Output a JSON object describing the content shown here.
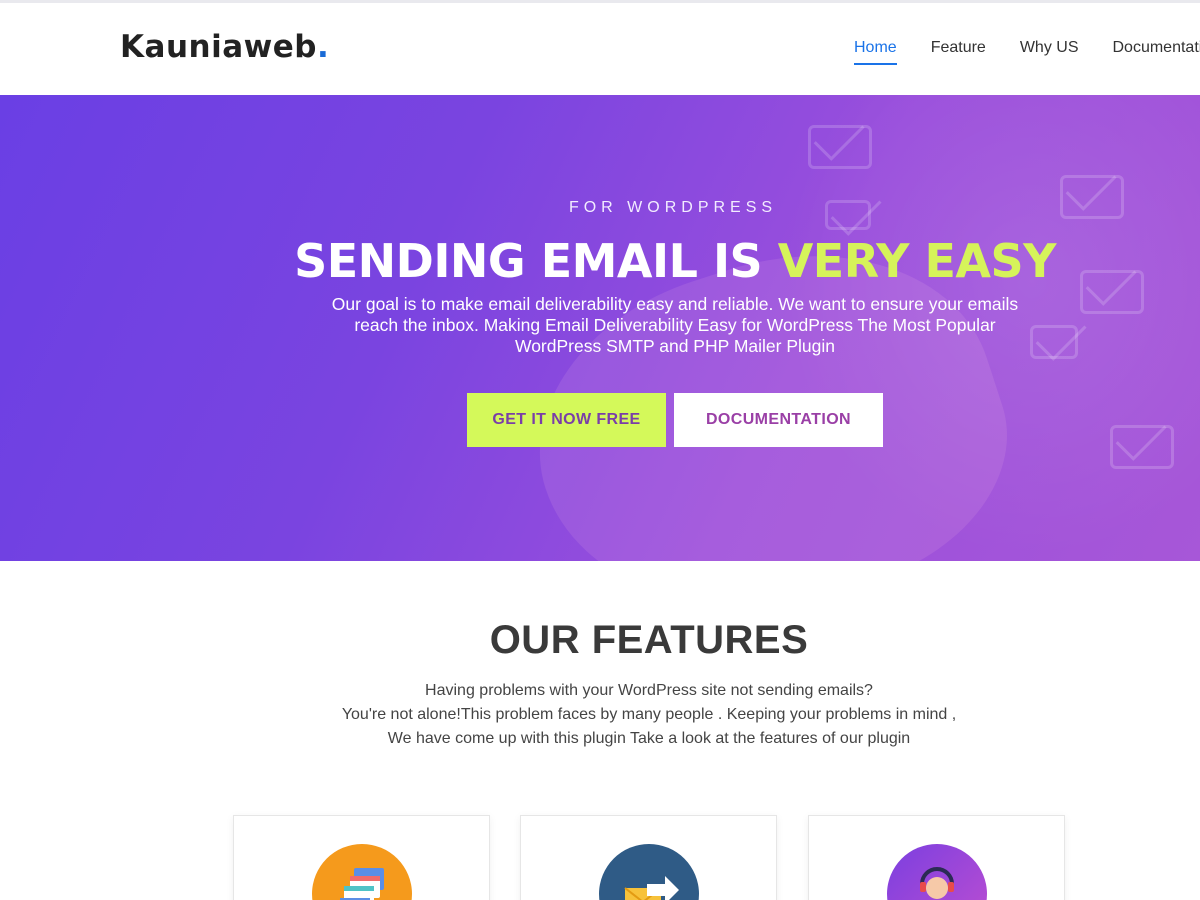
{
  "header": {
    "logo_text": "Kauniaweb",
    "logo_dot": ".",
    "nav": [
      "Home",
      "Feature",
      "Why US",
      "Documentation"
    ]
  },
  "hero": {
    "eyebrow": "FOR WORDPRESS",
    "headline_main": "SENDING EMAIL IS ",
    "headline_accent": "VERY EASY",
    "subtext": "Our goal is to make email deliverability easy and reliable. We want to ensure your emails reach the inbox. Making Email Deliverability Easy for WordPress The Most Popular WordPress SMTP and PHP Mailer Plugin",
    "primary_button": "GET IT NOW FREE",
    "secondary_button": "DOCUMENTATION"
  },
  "features": {
    "title": "OUR FEATURES",
    "description_lines": [
      "Having problems with your WordPress site not sending emails?",
      "You're not alone!This problem faces by many people . Keeping your problems in mind ,",
      "We have come up with this plugin Take a look at the features of our plugin"
    ],
    "cards": [
      {
        "icon": "browser-windows-icon",
        "color": "#f59a1c"
      },
      {
        "icon": "forward-mail-icon",
        "color": "#2f5b86"
      },
      {
        "icon": "support-agent-icon",
        "color": "#8a45dc"
      }
    ]
  },
  "colors": {
    "accent_blue": "#1a73e8",
    "hero_purple": "#7a44e0",
    "lime": "#d4f95a"
  }
}
